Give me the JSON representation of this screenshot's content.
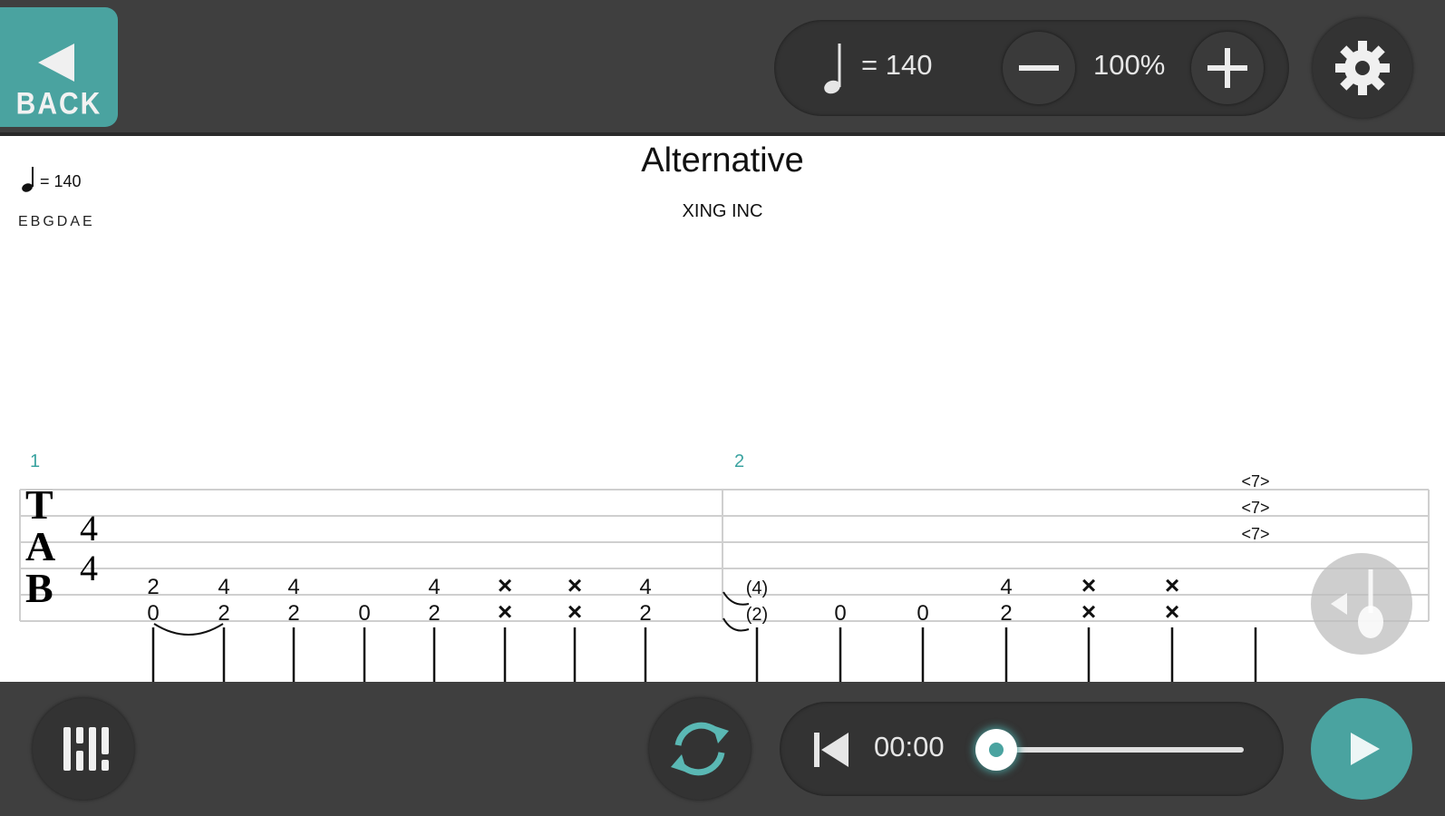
{
  "header": {
    "back_label": "BACK",
    "tempo_value": "= 140",
    "zoom_value": "100%",
    "accent_color": "#4aa3a0",
    "icons": [
      "back-arrow-icon",
      "quarter-note-icon",
      "minus-icon",
      "plus-icon",
      "gear-icon"
    ]
  },
  "score": {
    "tempo_value": "= 140",
    "tuning": "EBGDAE",
    "title": "Alternative",
    "artist": "XING INC",
    "clef_letters": [
      "T",
      "A",
      "B"
    ],
    "time_signature": {
      "top": "4",
      "bottom": "4"
    },
    "measures": [
      {
        "number": "1",
        "beats": [
          {
            "upper": "2",
            "lower": "0"
          },
          {
            "upper": "4",
            "lower": "2"
          },
          {
            "upper": "4",
            "lower": "2"
          },
          {
            "upper": "",
            "lower": "0"
          },
          {
            "upper": "4",
            "lower": "2"
          },
          {
            "upper": "×",
            "lower": "×"
          },
          {
            "upper": "×",
            "lower": "×"
          },
          {
            "upper": "4",
            "lower": "2"
          }
        ]
      },
      {
        "number": "2",
        "beats": [
          {
            "upper": "(4)",
            "lower": "(2)"
          },
          {
            "upper": "",
            "lower": "0"
          },
          {
            "upper": "",
            "lower": "0"
          },
          {
            "upper": "4",
            "lower": "2"
          },
          {
            "upper": "×",
            "lower": "×"
          },
          {
            "upper": "×",
            "lower": "×"
          }
        ],
        "harmonics": [
          "<7>",
          "<7>",
          "<7>"
        ]
      }
    ]
  },
  "playback": {
    "time": "00:00",
    "progress": 0.0,
    "icons": [
      "mixer-icon",
      "loop-icon",
      "rewind-icon",
      "play-icon",
      "guitar-icon"
    ]
  }
}
